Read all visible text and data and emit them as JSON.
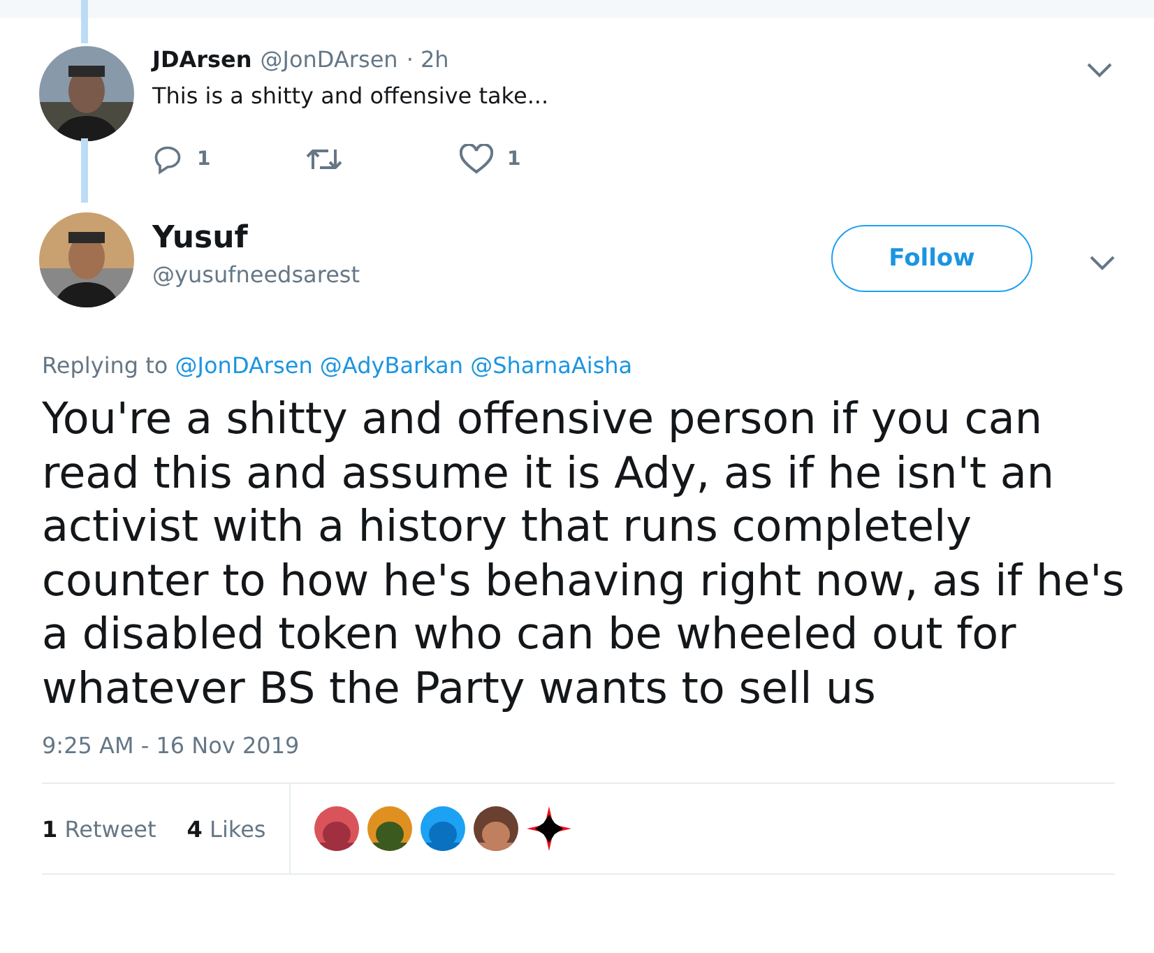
{
  "parent_tweet": {
    "name": "JDArsen",
    "handle": "@JonDArsen",
    "time": "· 2h",
    "text": "This is a shitty and offensive take...",
    "actions": [
      {
        "kind": "reply",
        "count": "1"
      },
      {
        "kind": "retweet"
      },
      {
        "kind": "like",
        "count": "1"
      }
    ]
  },
  "tweet": {
    "name": "Yusuf",
    "handle": "@yusufneedsarest",
    "follow_button": "Follow",
    "replying_label": "Replying to",
    "replying_to": [
      "@JonDArsen",
      "@AdyBarkan",
      "@SharnaAisha"
    ],
    "text": "You're a shitty and offensive person if you can read this and assume it is Ady, as if he isn't an activist with a history that runs completely counter to how he's behaving right now, as if he's a disabled token who can be wheeled out for whatever BS the Party wants to sell us",
    "timestamp": "9:25 AM - 16 Nov 2019",
    "stats": [
      {
        "count": "1",
        "label": "Retweet"
      },
      {
        "count": "4",
        "label": "Likes"
      }
    ],
    "likers": [
      {
        "kind": "picture"
      },
      {
        "kind": "picture"
      },
      {
        "kind": "picture"
      },
      {
        "kind": "picture"
      },
      {
        "kind": "star"
      }
    ]
  }
}
